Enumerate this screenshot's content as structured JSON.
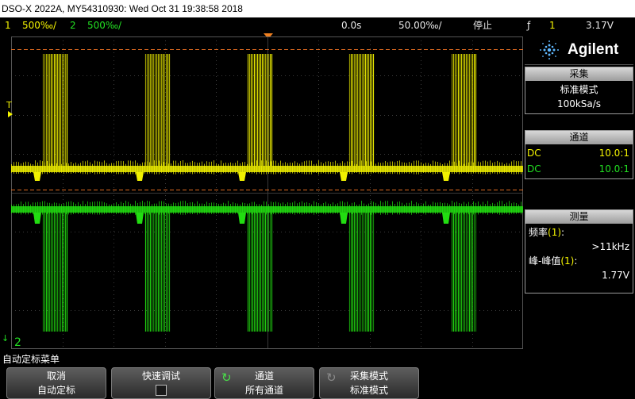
{
  "titlebar": {
    "text": "DSO-X 2022A, MY54310930: Wed Oct 31 19:38:58 2018"
  },
  "status": {
    "ch1_num": "1",
    "ch1_scale": "500‰/",
    "ch2_num": "2",
    "ch2_scale": "500‰/",
    "time_delay": "0.0s",
    "time_scale": "50.00‰/",
    "run_state": "停止",
    "trig_symbol": "ƒ",
    "trig_source": "1",
    "trig_level": "3.17V"
  },
  "screen": {
    "trigger_marker": "T",
    "ch2_marker": "2",
    "ground_marker": "↓",
    "colors": {
      "ch1": "#f0f000",
      "ch2": "#22dd11",
      "grid": "#3a3a3a",
      "cursor": "#e06a20"
    }
  },
  "panel": {
    "brand": "Agilent",
    "acquire": {
      "header": "采集",
      "mode": "标准模式",
      "rate": "100kSa/s"
    },
    "channels": {
      "header": "通道",
      "rows": [
        {
          "coupling": "DC",
          "probe": "10.0:1",
          "color": "#f4f400"
        },
        {
          "coupling": "DC",
          "probe": "10.0:1",
          "color": "#22e022"
        }
      ]
    },
    "measure": {
      "header": "测量",
      "freq_label": "频率",
      "freq_ch": "(1)",
      "freq_colon": ":",
      "freq_value": ">11kHz",
      "pp_label": "峰-峰值",
      "pp_ch": "(1)",
      "pp_colon": ":",
      "pp_value": "1.77V"
    }
  },
  "menu": {
    "title": "自动定标菜单",
    "keys": [
      {
        "line1": "取消",
        "line2": "自动定标"
      },
      {
        "line1": "快速调试"
      },
      {
        "line1": "通道",
        "line2": "所有通道"
      },
      {
        "line1": "采集模式",
        "line2": "标准模式"
      }
    ]
  }
}
